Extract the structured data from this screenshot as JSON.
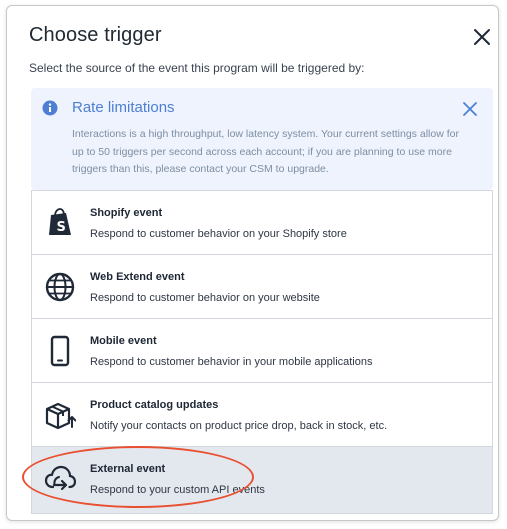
{
  "dialog": {
    "title": "Choose trigger",
    "subtitle": "Select the source of the event this program will be triggered by:"
  },
  "alert": {
    "title": "Rate limitations",
    "body": "Interactions is a high throughput, low latency system. Your current settings allow for up to 50 triggers per second across each account; if you are planning to use more triggers than this, please contact your CSM to upgrade."
  },
  "options": [
    {
      "title": "Shopify event",
      "description": "Respond to customer behavior on your Shopify store",
      "icon": "shopify-icon"
    },
    {
      "title": "Web Extend event",
      "description": "Respond to customer behavior on your website",
      "icon": "globe-icon"
    },
    {
      "title": "Mobile event",
      "description": "Respond to customer behavior in your mobile applications",
      "icon": "mobile-icon"
    },
    {
      "title": "Product catalog updates",
      "description": "Notify your contacts on product price drop, back in stock, etc.",
      "icon": "package-icon"
    },
    {
      "title": "External event",
      "description": "Respond to your custom API events",
      "icon": "cloud-arrow-icon",
      "selected": true
    }
  ],
  "colors": {
    "alert_background": "#eef3fd",
    "alert_accent": "#4d7fd3",
    "selected_row": "#e3e7ee",
    "annotation_circle": "#e8502f"
  }
}
